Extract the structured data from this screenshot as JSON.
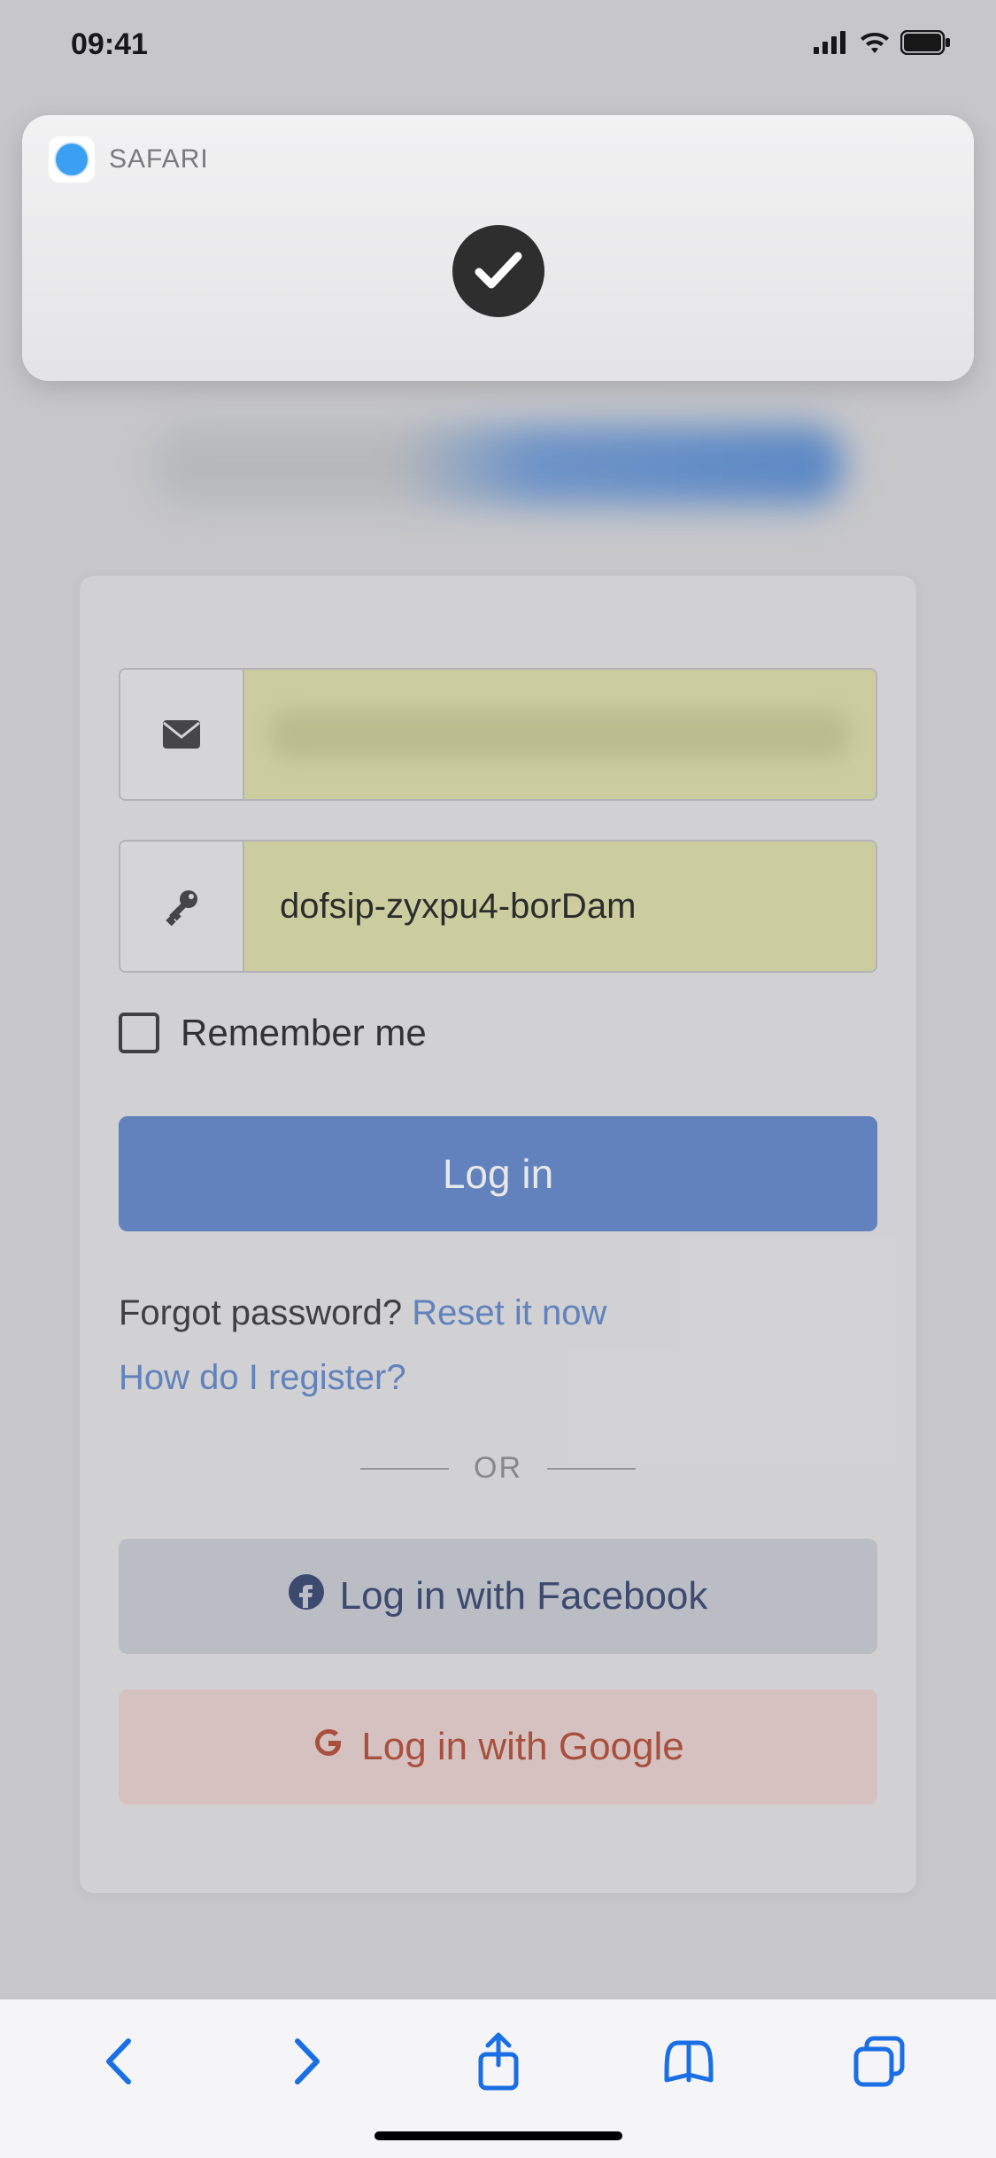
{
  "status": {
    "time": "09:41"
  },
  "notification": {
    "app_name": "SAFARI"
  },
  "login": {
    "email_value": "",
    "password_value": "dofsip-zyxpu4-borDam",
    "remember_label": "Remember me",
    "login_button": "Log in",
    "forgot_prefix": "Forgot password? ",
    "reset_link": "Reset it now",
    "register_link": "How do I register?",
    "divider_text": "OR",
    "facebook_button": "Log in with Facebook",
    "google_button": "Log in with Google"
  }
}
